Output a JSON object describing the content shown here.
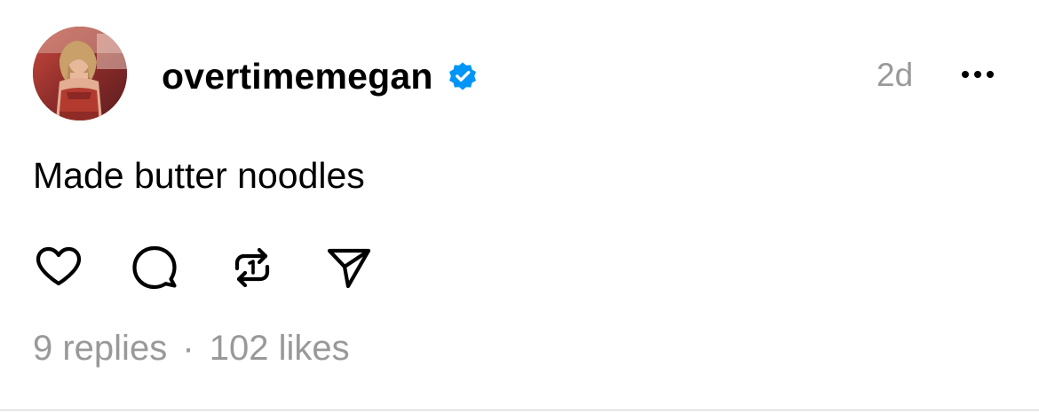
{
  "post": {
    "author": {
      "username": "overtimemegan",
      "verified": true,
      "avatar": "profile-photo"
    },
    "timestamp": "2d",
    "more_icon": "more-horizontal-icon",
    "text": "Made butter noodles",
    "actions": [
      {
        "name": "like",
        "icon": "heart-icon"
      },
      {
        "name": "reply",
        "icon": "comment-bubble-icon"
      },
      {
        "name": "repost",
        "icon": "repost-icon"
      },
      {
        "name": "share",
        "icon": "send-icon"
      }
    ],
    "stats": {
      "replies": "9 replies",
      "separator": "·",
      "likes": "102 likes"
    }
  },
  "colors": {
    "text": "#000000",
    "muted": "#999999",
    "verified_blue": "#0095F6",
    "divider": "#E6E6E6"
  }
}
